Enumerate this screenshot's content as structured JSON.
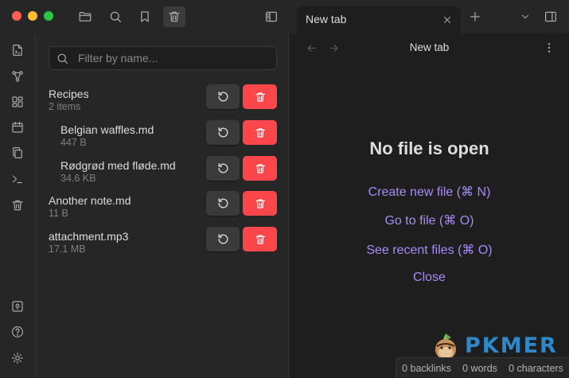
{
  "tabs": [
    {
      "label": "New tab"
    }
  ],
  "filter": {
    "placeholder": "Filter by name..."
  },
  "items": [
    {
      "name": "Recipes",
      "meta": "2 items",
      "indent": false
    },
    {
      "name": "Belgian waffles.md",
      "meta": "447 B",
      "indent": true
    },
    {
      "name": "Rødgrød med fløde.md",
      "meta": "34.6 KB",
      "indent": true
    },
    {
      "name": "Another note.md",
      "meta": "11 B",
      "indent": false
    },
    {
      "name": "attachment.mp3",
      "meta": "17.1 MB",
      "indent": false
    }
  ],
  "main": {
    "view_title": "New tab",
    "empty_title": "No file is open",
    "actions": [
      "Create new file (⌘ N)",
      "Go to file (⌘ O)",
      "See recent files (⌘ O)",
      "Close"
    ]
  },
  "status": {
    "backlinks": "0 backlinks",
    "words": "0 words",
    "characters": "0 characters"
  },
  "watermark": {
    "text": "PKMER"
  },
  "icons": {
    "titlebar": [
      "folder-icon",
      "search-icon",
      "bookmark-icon",
      "trash-icon",
      "sidebar-toggle-icon"
    ],
    "ribbon": [
      "new-note-icon",
      "graph-icon",
      "canvas-icon",
      "calendar-icon",
      "copy-icon",
      "terminal-icon",
      "trash-icon",
      "vault-icon",
      "help-icon",
      "settings-icon"
    ]
  },
  "colors": {
    "accent": "#a88bfa",
    "delete": "#fb464c",
    "watermark": "#2e88c9"
  }
}
